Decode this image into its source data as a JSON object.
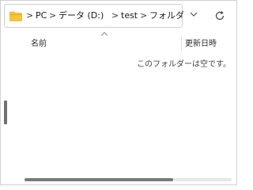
{
  "address_bar": {
    "breadcrumbs": [
      "PC",
      "データ (D:)",
      "test",
      "フォルダ"
    ],
    "separator": ">",
    "folder_icon": "folder-icon",
    "dropdown_icon": "chevron-down-icon",
    "refresh_icon": "refresh-icon"
  },
  "columns": {
    "name_label": "名前",
    "date_label": "更新日時",
    "sort_icon": "chevron-up-icon"
  },
  "content": {
    "empty_message": "このフォルダーは空です。"
  },
  "colors": {
    "folder_fill": "#f4c542",
    "folder_tab": "#e0a820",
    "scrollbar_thumb": "#7a7a7a"
  }
}
